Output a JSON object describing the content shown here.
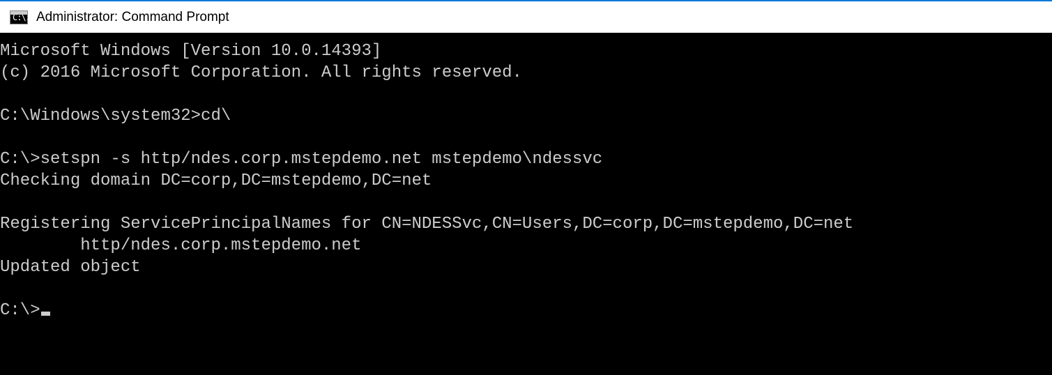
{
  "window": {
    "title": "Administrator: Command Prompt",
    "icon_text": "C:\\."
  },
  "terminal": {
    "lines": [
      "Microsoft Windows [Version 10.0.14393]",
      "(c) 2016 Microsoft Corporation. All rights reserved.",
      "",
      "C:\\Windows\\system32>cd\\",
      "",
      "C:\\>setspn -s http/ndes.corp.mstepdemo.net mstepdemo\\ndessvc",
      "Checking domain DC=corp,DC=mstepdemo,DC=net",
      "",
      "Registering ServicePrincipalNames for CN=NDESSvc,CN=Users,DC=corp,DC=mstepdemo,DC=net",
      "        http/ndes.corp.mstepdemo.net",
      "Updated object",
      "",
      "C:\\>"
    ]
  }
}
